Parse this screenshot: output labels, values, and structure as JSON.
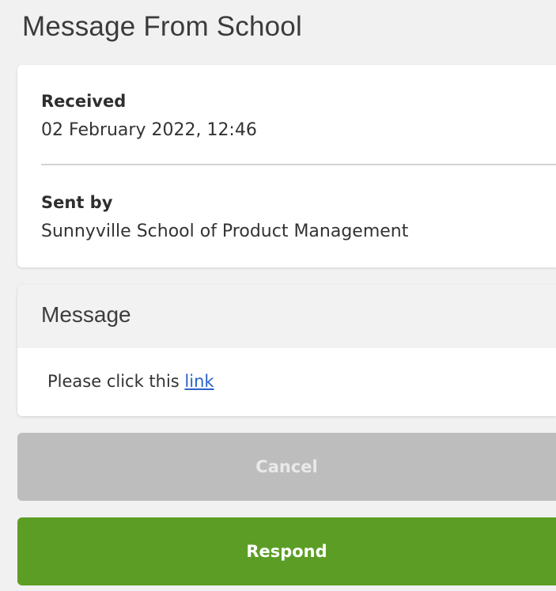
{
  "header": {
    "title": "Message From School"
  },
  "details": {
    "received_label": "Received",
    "received_value": "02 February 2022, 12:46",
    "sent_by_label": "Sent by",
    "sent_by_value": "Sunnyville School of Product Management"
  },
  "message": {
    "heading": "Message",
    "body_text": "Please click this ",
    "link_text": "link"
  },
  "actions": {
    "cancel_label": "Cancel",
    "respond_label": "Respond"
  },
  "colors": {
    "respond_green": "#5c9e25",
    "cancel_gray": "#bdbdbd",
    "link_blue": "#2b62c8",
    "background": "#f1f1f1"
  }
}
